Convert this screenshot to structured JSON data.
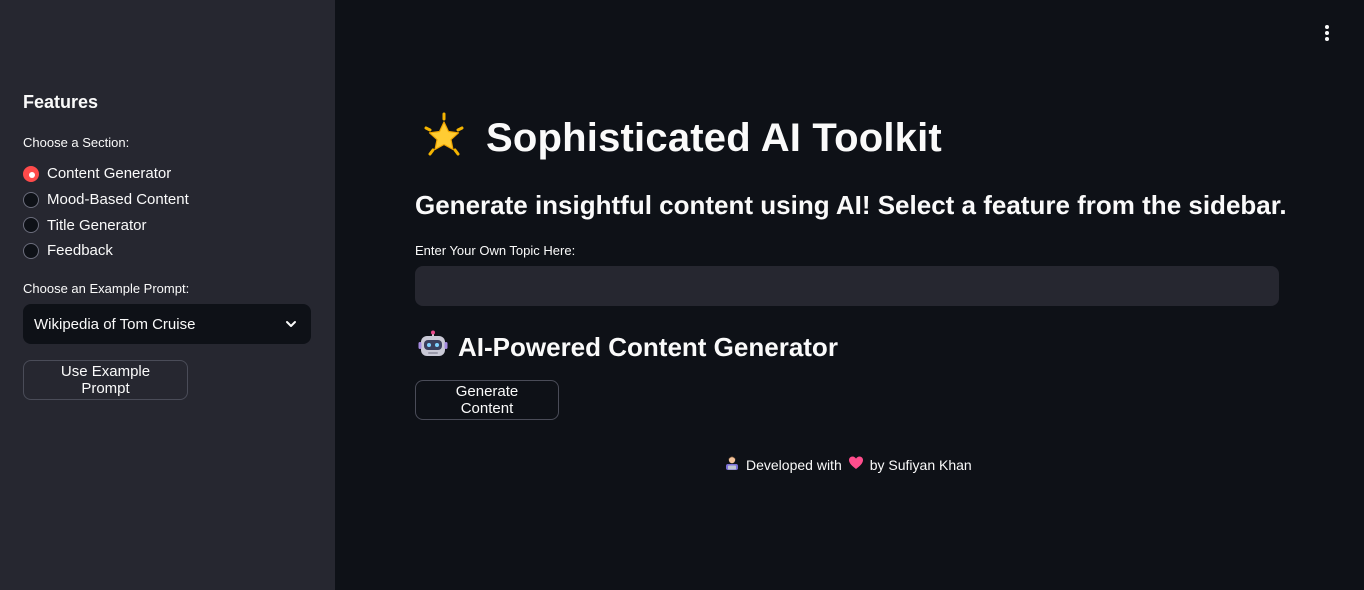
{
  "sidebar": {
    "title": "Features",
    "section_label": "Choose a Section:",
    "sections": [
      {
        "label": "Content Generator",
        "selected": true
      },
      {
        "label": "Mood-Based Content",
        "selected": false
      },
      {
        "label": "Title Generator",
        "selected": false
      },
      {
        "label": "Feedback",
        "selected": false
      }
    ],
    "prompt_label": "Choose an Example Prompt:",
    "prompt_selected": "Wikipedia of Tom Cruise",
    "use_example_button": "Use Example Prompt"
  },
  "main": {
    "title": "Sophisticated AI Toolkit",
    "title_icon": "glowing-star-icon",
    "subtitle": "Generate insightful content using AI! Select a feature from the sidebar.",
    "topic_label": "Enter Your Own Topic Here:",
    "topic_value": "",
    "section_heading": "AI-Powered Content Generator",
    "section_icon": "robot-icon",
    "generate_button": "Generate Content"
  },
  "footer": {
    "developed_with": "Developed with",
    "by": "by Sufiyan Khan",
    "icons": [
      "technologist-icon",
      "heart-icon"
    ]
  },
  "colors": {
    "background": "#0e1117",
    "sidebar": "#262730",
    "accent": "#ff4b4b",
    "text": "#fafafa"
  }
}
